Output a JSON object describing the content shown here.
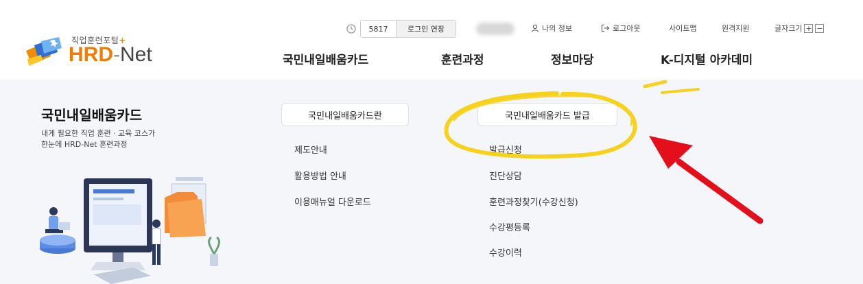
{
  "logo": {
    "subtitle": "직업훈련포털",
    "subtitle_plus": "+",
    "hrd": "HRD",
    "dash": "-",
    "net": "Net"
  },
  "util": {
    "timer_count": "5817",
    "extend_label": "로그인 연장",
    "my_info": "나의 정보",
    "logout": "로그아웃",
    "sitemap": "사이트맵",
    "remote_support": "원격지원",
    "font_size": "글자크기",
    "font_plus": "+",
    "font_minus": "−"
  },
  "gnb": [
    "국민내일배움카드",
    "훈련과정",
    "정보마당",
    "K-디지털 아카데미"
  ],
  "panel": {
    "title": "국민내일배움카드",
    "desc_line1": "내게 필요한 직업 훈련 · 교육 코스가",
    "desc_line2": "한눈에 HRD-Net 훈련과정",
    "col1": {
      "header": "국민내일배움카드란",
      "links": [
        "제도안내",
        "활용방법 안내",
        "이용매뉴얼 다운로드"
      ]
    },
    "col2": {
      "header": "국민내일배움카드 발급",
      "links": [
        "발급신청",
        "진단상담",
        "훈련과정찾기(수강신청)",
        "수강평등록",
        "수강이력"
      ]
    }
  },
  "colors": {
    "brand_orange": "#f07d00",
    "panel_bg": "#f4f6fa",
    "highlight_yellow": "#f7d21c",
    "arrow_red": "#e3101b"
  },
  "icons": {
    "timer": "clock-icon",
    "my_info": "person-icon",
    "logout": "logout-icon"
  }
}
